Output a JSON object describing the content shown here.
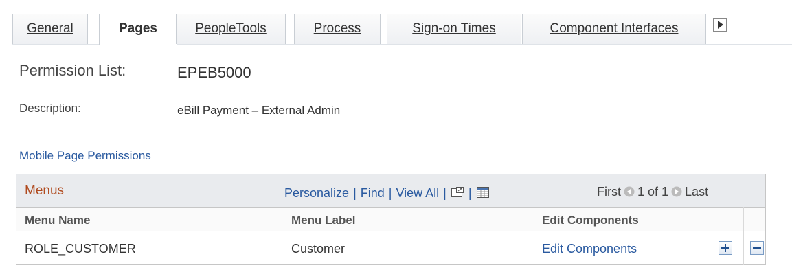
{
  "tabs": [
    {
      "label": "General",
      "active": false
    },
    {
      "label": "Pages",
      "active": true
    },
    {
      "label": "PeopleTools",
      "active": false
    },
    {
      "label": "Process",
      "active": false
    },
    {
      "label": "Sign-on Times",
      "active": false
    },
    {
      "label": "Component Interfaces",
      "active": false
    }
  ],
  "header": {
    "permission_list_label": "Permission List:",
    "permission_list_value": "EPEB5000",
    "description_label": "Description:",
    "description_value": "eBill Payment – External Admin",
    "section_link": "Mobile Page Permissions"
  },
  "grid": {
    "title": "Menus",
    "nav": {
      "personalize": "Personalize",
      "find": "Find",
      "view_all": "View All",
      "sep": "|"
    },
    "pager": {
      "first": "First",
      "range": "1 of 1",
      "last": "Last"
    },
    "columns": {
      "menu_name": "Menu Name",
      "menu_label": "Menu Label",
      "edit_components": "Edit Components"
    },
    "rows": [
      {
        "menu_name": "ROLE_CUSTOMER",
        "menu_label": "Customer",
        "edit_components": "Edit Components"
      }
    ]
  },
  "colors": {
    "link": "#2a5aa0",
    "grid_title": "#b04a1e",
    "header_bg": "#e9ebee"
  },
  "icons": [
    "tab-scroll-right-icon",
    "zoom-icon",
    "download-spreadsheet-icon",
    "previous-arrow-icon",
    "next-arrow-icon",
    "add-row-icon",
    "delete-row-icon"
  ]
}
